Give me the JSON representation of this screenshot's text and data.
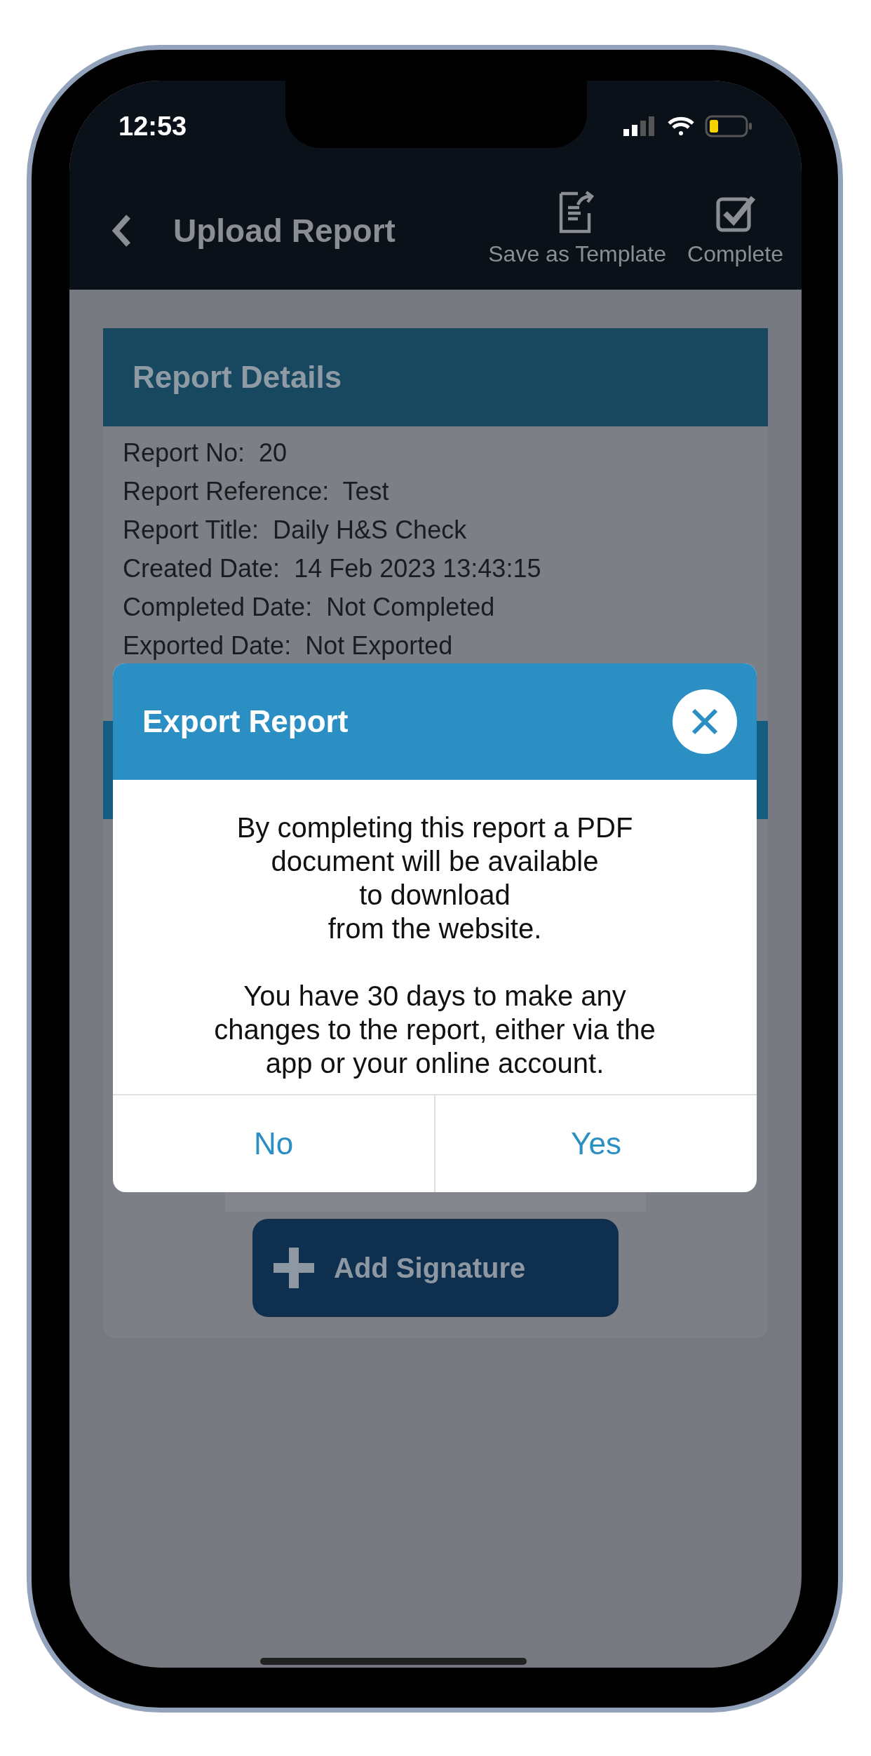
{
  "status_bar": {
    "time": "12:53"
  },
  "header": {
    "title": "Upload Report",
    "actions": [
      {
        "kind": "template",
        "label": "Save as Template"
      },
      {
        "kind": "complete",
        "label": "Complete"
      }
    ]
  },
  "report_details": {
    "title": "Report Details",
    "fields": [
      {
        "label": "Report No:",
        "value": "20"
      },
      {
        "label": "Report Reference:",
        "value": "Test"
      },
      {
        "label": "Report Title:",
        "value": "Daily H&S Check"
      },
      {
        "label": "Created Date:",
        "value": "14 Feb 2023 13:43:15"
      },
      {
        "label": "Completed Date:",
        "value": "Not Completed"
      },
      {
        "label": "Exported Date:",
        "value": "Not Exported"
      }
    ]
  },
  "add_signature_button": {
    "label": "Add Signature"
  },
  "dialog": {
    "title": "Export Report",
    "paragraphs": [
      "By completing this report a PDF\ndocument will be available\nto download\nfrom the website.",
      "You have 30 days to make any\nchanges to the report, either via the\napp or your online account."
    ],
    "buttons": [
      "No",
      "Yes"
    ]
  }
}
